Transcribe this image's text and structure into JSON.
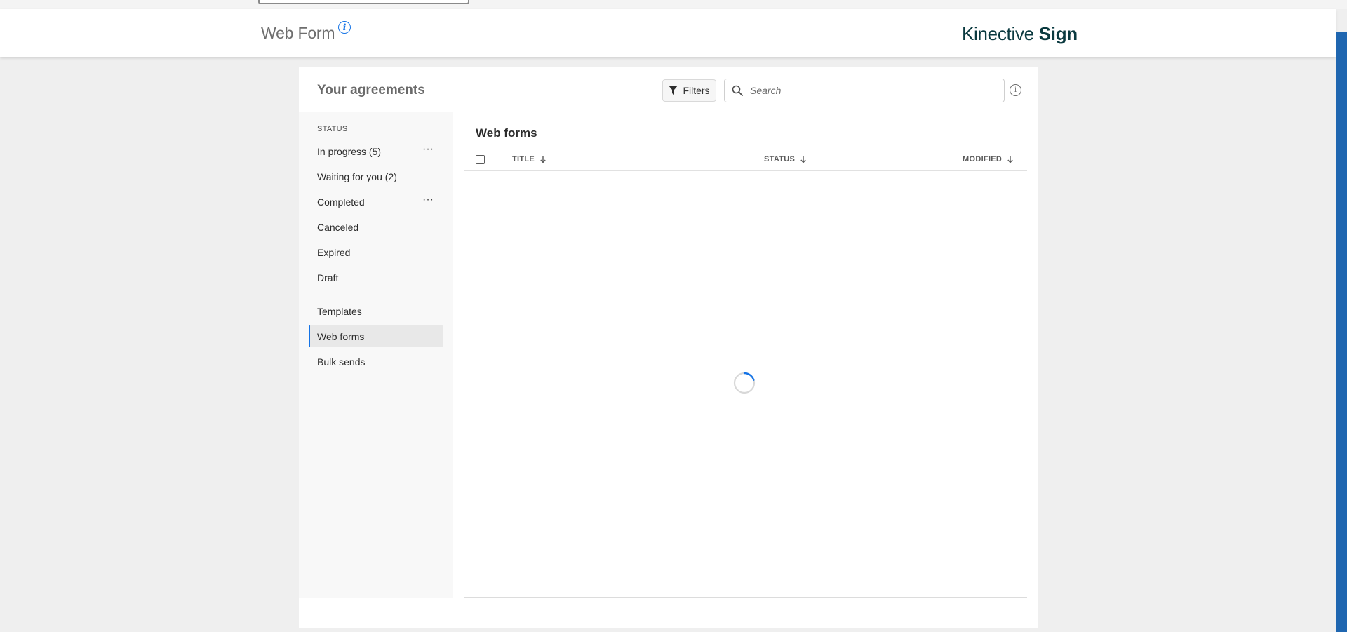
{
  "header": {
    "title": "Web Form",
    "info_glyph": "i",
    "brand_light": "Kinective",
    "brand_bold": "Sign"
  },
  "panel": {
    "title": "Your agreements",
    "filters_label": "Filters",
    "search_placeholder": "Search",
    "info_glyph": "i"
  },
  "sidebar": {
    "status_heading": "STATUS",
    "more_glyph": "···",
    "status_items": [
      {
        "label": "In progress (5)"
      },
      {
        "label": "Waiting for you (2)"
      },
      {
        "label": "Completed"
      },
      {
        "label": "Canceled"
      },
      {
        "label": "Expired"
      },
      {
        "label": "Draft"
      }
    ],
    "other_items": [
      {
        "label": "Templates"
      },
      {
        "label": "Web forms"
      },
      {
        "label": "Bulk sends"
      }
    ],
    "active_item": "Web forms"
  },
  "list": {
    "title": "Web forms",
    "columns": {
      "title": "TITLE",
      "status": "STATUS",
      "modified": "MODIFIED"
    },
    "state": "loading"
  },
  "colors": {
    "accent": "#1473e6",
    "brand": "#0b3a40",
    "scrollbar": "#1f66b0"
  },
  "icons": {
    "filter": "filter-funnel-icon",
    "search": "search-icon",
    "info": "info-icon",
    "more": "more-horizontal-icon",
    "sort": "arrow-down-icon",
    "loading": "spinner-icon"
  }
}
